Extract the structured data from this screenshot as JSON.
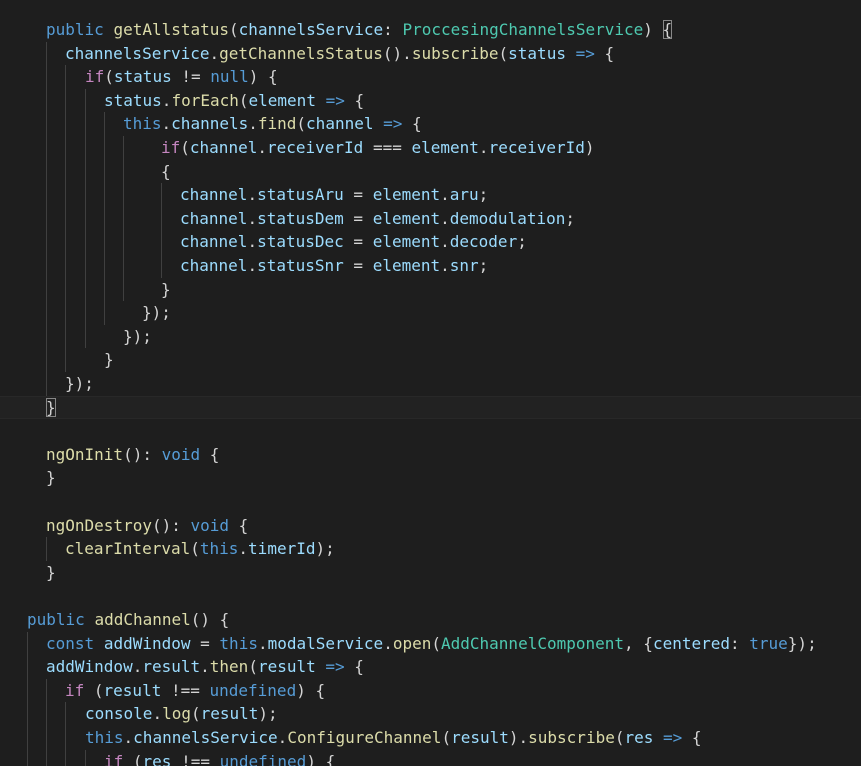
{
  "editor": {
    "theme_colors": {
      "background": "#1e1e1e",
      "keyword": "#569cd6",
      "control": "#c586c0",
      "function": "#dcdcaa",
      "variable": "#9cdcfe",
      "type": "#4ec9b0",
      "text": "#d4d4d4"
    },
    "lines": [
      {
        "id": "l1",
        "tokens": [
          [
            "kw",
            "public"
          ],
          [
            "t",
            " "
          ],
          [
            "fn",
            "getAllstatus"
          ],
          [
            "t",
            "("
          ],
          [
            "var",
            "channelsService"
          ],
          [
            "t",
            ": "
          ],
          [
            "type",
            "ProccesingChannelsService"
          ],
          [
            "t",
            ") "
          ],
          [
            "match",
            "{"
          ]
        ]
      },
      {
        "id": "l2",
        "tokens": [
          [
            "var",
            "channelsService"
          ],
          [
            "t",
            "."
          ],
          [
            "fn",
            "getChannelsStatus"
          ],
          [
            "t",
            "()."
          ],
          [
            "fn",
            "subscribe"
          ],
          [
            "t",
            "("
          ],
          [
            "var",
            "status"
          ],
          [
            "t",
            " "
          ],
          [
            "kw",
            "=>"
          ],
          [
            "t",
            " {"
          ]
        ]
      },
      {
        "id": "l3",
        "tokens": [
          [
            "ctl",
            "if"
          ],
          [
            "t",
            "("
          ],
          [
            "var",
            "status"
          ],
          [
            "t",
            " != "
          ],
          [
            "kw",
            "null"
          ],
          [
            "t",
            ") {"
          ]
        ]
      },
      {
        "id": "l4",
        "tokens": [
          [
            "var",
            "status"
          ],
          [
            "t",
            "."
          ],
          [
            "fn",
            "forEach"
          ],
          [
            "t",
            "("
          ],
          [
            "var",
            "element"
          ],
          [
            "t",
            " "
          ],
          [
            "kw",
            "=>"
          ],
          [
            "t",
            " {"
          ]
        ]
      },
      {
        "id": "l5",
        "tokens": [
          [
            "kw",
            "this"
          ],
          [
            "t",
            "."
          ],
          [
            "var",
            "channels"
          ],
          [
            "t",
            "."
          ],
          [
            "fn",
            "find"
          ],
          [
            "t",
            "("
          ],
          [
            "var",
            "channel"
          ],
          [
            "t",
            " "
          ],
          [
            "kw",
            "=>"
          ],
          [
            "t",
            " {"
          ]
        ]
      },
      {
        "id": "l6",
        "tokens": [
          [
            "ctl",
            "if"
          ],
          [
            "t",
            "("
          ],
          [
            "var",
            "channel"
          ],
          [
            "t",
            "."
          ],
          [
            "var",
            "receiverId"
          ],
          [
            "t",
            " === "
          ],
          [
            "var",
            "element"
          ],
          [
            "t",
            "."
          ],
          [
            "var",
            "receiverId"
          ],
          [
            "t",
            ")"
          ]
        ]
      },
      {
        "id": "l7",
        "tokens": [
          [
            "t",
            "{"
          ]
        ]
      },
      {
        "id": "l8",
        "tokens": [
          [
            "var",
            "channel"
          ],
          [
            "t",
            "."
          ],
          [
            "var",
            "statusAru"
          ],
          [
            "t",
            " = "
          ],
          [
            "var",
            "element"
          ],
          [
            "t",
            "."
          ],
          [
            "var",
            "aru"
          ],
          [
            "t",
            ";"
          ]
        ]
      },
      {
        "id": "l9",
        "tokens": [
          [
            "var",
            "channel"
          ],
          [
            "t",
            "."
          ],
          [
            "var",
            "statusDem"
          ],
          [
            "t",
            " = "
          ],
          [
            "var",
            "element"
          ],
          [
            "t",
            "."
          ],
          [
            "var",
            "demodulation"
          ],
          [
            "t",
            ";"
          ]
        ]
      },
      {
        "id": "l10",
        "tokens": [
          [
            "var",
            "channel"
          ],
          [
            "t",
            "."
          ],
          [
            "var",
            "statusDec"
          ],
          [
            "t",
            " = "
          ],
          [
            "var",
            "element"
          ],
          [
            "t",
            "."
          ],
          [
            "var",
            "decoder"
          ],
          [
            "t",
            ";"
          ]
        ]
      },
      {
        "id": "l11",
        "tokens": [
          [
            "var",
            "channel"
          ],
          [
            "t",
            "."
          ],
          [
            "var",
            "statusSnr"
          ],
          [
            "t",
            " = "
          ],
          [
            "var",
            "element"
          ],
          [
            "t",
            "."
          ],
          [
            "var",
            "snr"
          ],
          [
            "t",
            ";"
          ]
        ]
      },
      {
        "id": "l12",
        "tokens": [
          [
            "t",
            "}"
          ]
        ]
      },
      {
        "id": "l13",
        "tokens": [
          [
            "t",
            "});"
          ]
        ]
      },
      {
        "id": "l14",
        "tokens": [
          [
            "t",
            "});"
          ]
        ]
      },
      {
        "id": "l15",
        "tokens": [
          [
            "t",
            "}"
          ]
        ]
      },
      {
        "id": "l16",
        "tokens": [
          [
            "t",
            "});"
          ]
        ]
      },
      {
        "id": "l17",
        "tokens": [
          [
            "match",
            "}"
          ]
        ]
      },
      {
        "id": "l18",
        "tokens": []
      },
      {
        "id": "l19",
        "tokens": [
          [
            "fn",
            "ngOnInit"
          ],
          [
            "t",
            "(): "
          ],
          [
            "kw",
            "void"
          ],
          [
            "t",
            " {"
          ]
        ]
      },
      {
        "id": "l20",
        "tokens": [
          [
            "t",
            "}"
          ]
        ]
      },
      {
        "id": "l21",
        "tokens": []
      },
      {
        "id": "l22",
        "tokens": [
          [
            "fn",
            "ngOnDestroy"
          ],
          [
            "t",
            "(): "
          ],
          [
            "kw",
            "void"
          ],
          [
            "t",
            " {"
          ]
        ]
      },
      {
        "id": "l23",
        "tokens": [
          [
            "fn",
            "clearInterval"
          ],
          [
            "t",
            "("
          ],
          [
            "kw",
            "this"
          ],
          [
            "t",
            "."
          ],
          [
            "var",
            "timerId"
          ],
          [
            "t",
            ");"
          ]
        ]
      },
      {
        "id": "l24",
        "tokens": [
          [
            "t",
            "}"
          ]
        ]
      },
      {
        "id": "l25",
        "tokens": []
      },
      {
        "id": "l26",
        "tokens": [
          [
            "kw",
            "public"
          ],
          [
            "t",
            " "
          ],
          [
            "fn",
            "addChannel"
          ],
          [
            "t",
            "() {"
          ]
        ]
      },
      {
        "id": "l27",
        "tokens": [
          [
            "kw",
            "const"
          ],
          [
            "t",
            " "
          ],
          [
            "var",
            "addWindow"
          ],
          [
            "t",
            " = "
          ],
          [
            "kw",
            "this"
          ],
          [
            "t",
            "."
          ],
          [
            "var",
            "modalService"
          ],
          [
            "t",
            "."
          ],
          [
            "fn",
            "open"
          ],
          [
            "t",
            "("
          ],
          [
            "type",
            "AddChannelComponent"
          ],
          [
            "t",
            ", {"
          ],
          [
            "var",
            "centered"
          ],
          [
            "t",
            ": "
          ],
          [
            "kw",
            "true"
          ],
          [
            "t",
            "});"
          ]
        ]
      },
      {
        "id": "l28",
        "tokens": [
          [
            "var",
            "addWindow"
          ],
          [
            "t",
            "."
          ],
          [
            "var",
            "result"
          ],
          [
            "t",
            "."
          ],
          [
            "fn",
            "then"
          ],
          [
            "t",
            "("
          ],
          [
            "var",
            "result"
          ],
          [
            "t",
            " "
          ],
          [
            "kw",
            "=>"
          ],
          [
            "t",
            " {"
          ]
        ]
      },
      {
        "id": "l29",
        "tokens": [
          [
            "ctl",
            "if"
          ],
          [
            "t",
            " ("
          ],
          [
            "var",
            "result"
          ],
          [
            "t",
            " !== "
          ],
          [
            "kw",
            "undefined"
          ],
          [
            "t",
            ") {"
          ]
        ]
      },
      {
        "id": "l30",
        "tokens": [
          [
            "var",
            "console"
          ],
          [
            "t",
            "."
          ],
          [
            "fn",
            "log"
          ],
          [
            "t",
            "("
          ],
          [
            "var",
            "result"
          ],
          [
            "t",
            ");"
          ]
        ]
      },
      {
        "id": "l31",
        "tokens": [
          [
            "kw",
            "this"
          ],
          [
            "t",
            "."
          ],
          [
            "var",
            "channelsService"
          ],
          [
            "t",
            "."
          ],
          [
            "fn",
            "ConfigureChannel"
          ],
          [
            "t",
            "("
          ],
          [
            "var",
            "result"
          ],
          [
            "t",
            ")."
          ],
          [
            "fn",
            "subscribe"
          ],
          [
            "t",
            "("
          ],
          [
            "var",
            "res"
          ],
          [
            "t",
            " "
          ],
          [
            "kw",
            "=>"
          ],
          [
            "t",
            " {"
          ]
        ]
      },
      {
        "id": "l32",
        "tokens": [
          [
            "ctl",
            "if"
          ],
          [
            "t",
            " ("
          ],
          [
            "var",
            "res"
          ],
          [
            "t",
            " !== "
          ],
          [
            "kw",
            "undefined"
          ],
          [
            "t",
            ") {"
          ]
        ]
      }
    ]
  }
}
